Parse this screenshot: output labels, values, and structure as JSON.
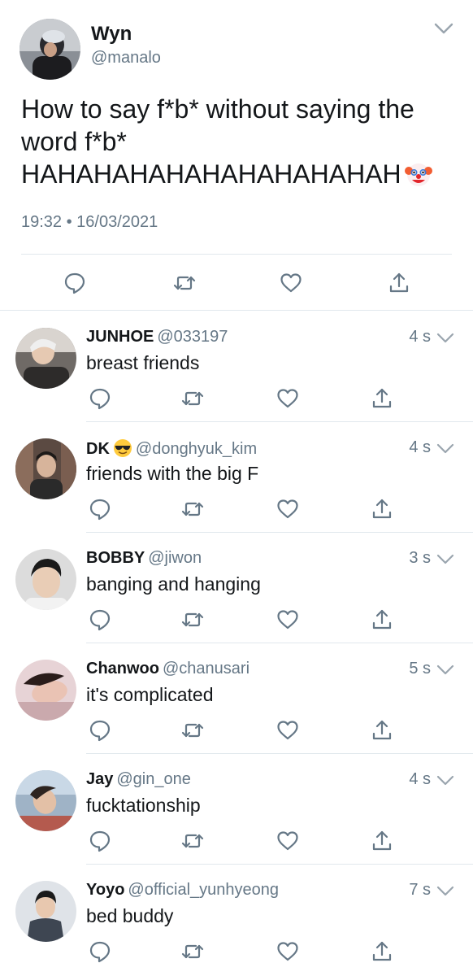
{
  "main_tweet": {
    "name": "Wyn",
    "handle": "@manalo",
    "text_line1": "How to say f*b* without saying the",
    "text_line2": "word f*b*",
    "text_line3": "HAHAHAHAHAHAHAHAHAHAH",
    "timestamp": "19:32 • 16/03/2021",
    "text_emoji": "clown-face"
  },
  "replies": [
    {
      "name": "JUNHOE",
      "handle": "@033197",
      "time": "4 s",
      "text": "breast friends"
    },
    {
      "name": "DK",
      "name_emoji": "smiling-face-with-sunglasses",
      "handle": "@donghyuk_kim",
      "time": "4 s",
      "text": "friends with the big F"
    },
    {
      "name": "BOBBY",
      "handle": "@jiwon",
      "time": "3 s",
      "text": "banging and hanging"
    },
    {
      "name": "Chanwoo",
      "handle": "@chanusari",
      "time": "5 s",
      "text": "it's complicated"
    },
    {
      "name": "Jay",
      "handle": "@gin_one",
      "time": "4 s",
      "text": "fucktationship"
    },
    {
      "name": "Yoyo",
      "handle": "@official_yunhyeong",
      "time": "7 s",
      "text": "bed buddy"
    }
  ],
  "action_icons": [
    "reply-icon",
    "retweet-icon",
    "like-icon",
    "share-icon"
  ],
  "colors": {
    "text": "#14171a",
    "secondary": "#657786",
    "icon": "#657786",
    "divider": "#e1e8ed",
    "background": "#ffffff"
  }
}
